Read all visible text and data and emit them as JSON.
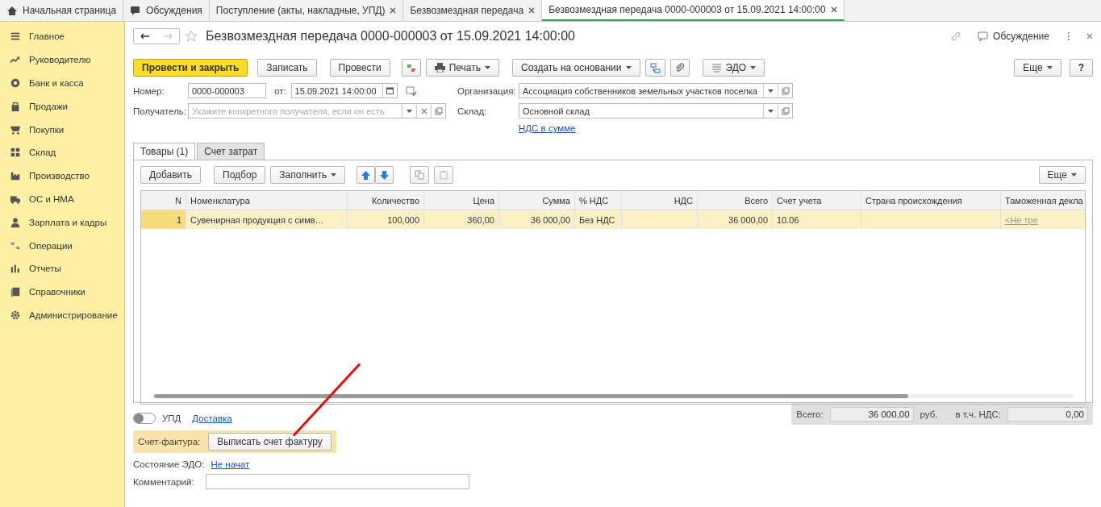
{
  "top_tabs": [
    {
      "label": "Начальная страница",
      "kind": "home",
      "closable": false,
      "selected": false
    },
    {
      "label": "Обсуждения",
      "kind": "chat",
      "closable": false,
      "selected": false
    },
    {
      "label": "Поступление (акты, накладные, УПД)",
      "kind": "doc",
      "closable": true,
      "selected": false
    },
    {
      "label": "Безвозмездная передача",
      "kind": "doc",
      "closable": true,
      "selected": false
    },
    {
      "label": "Безвозмездная передача 0000-000003 от 15.09.2021 14:00:00",
      "kind": "doc",
      "closable": true,
      "selected": true
    }
  ],
  "sidebar": {
    "items": [
      {
        "label": "Главное"
      },
      {
        "label": "Руководителю"
      },
      {
        "label": "Банк и касса"
      },
      {
        "label": "Продажи"
      },
      {
        "label": "Покупки"
      },
      {
        "label": "Склад"
      },
      {
        "label": "Производство"
      },
      {
        "label": "ОС и НМА"
      },
      {
        "label": "Зарплата и кадры"
      },
      {
        "label": "Операции"
      },
      {
        "label": "Отчеты"
      },
      {
        "label": "Справочники"
      },
      {
        "label": "Администрирование"
      }
    ]
  },
  "form": {
    "title": "Безвозмездная передача 0000-000003 от 15.09.2021 14:00:00",
    "discussion": "Обсуждение",
    "toolbar": {
      "post_close": "Провести и закрыть",
      "save": "Записать",
      "post": "Провести",
      "print": "Печать",
      "create_based": "Создать на основании",
      "edo": "ЭДО",
      "more": "Еще",
      "help": "?"
    },
    "number_label": "Номер:",
    "number": "0000-000003",
    "date_label": "от:",
    "date": "15.09.2021 14:00:00",
    "org_label": "Организация:",
    "org": "Ассоциация собственников земельных участков поселка",
    "recipient_label": "Получатель:",
    "recipient_placeholder": "Укажите конкретного получателя, если он есть",
    "warehouse_label": "Склад:",
    "warehouse": "Основной склад",
    "vat_link": "НДС в сумме",
    "tabs": [
      {
        "label": "Товары (1)",
        "selected": true
      },
      {
        "label": "Счет затрат",
        "selected": false
      }
    ],
    "table_toolbar": {
      "add": "Добавить",
      "pick": "Подбор",
      "fill": "Заполнить",
      "more": "Еще"
    },
    "table": {
      "columns": [
        "N",
        "Номенклатура",
        "Количество",
        "Цена",
        "Сумма",
        "% НДС",
        "НДС",
        "Всего",
        "Счет учета",
        "Страна происхождения",
        "Таможенная декла"
      ],
      "rows": [
        {
          "selected": true,
          "cells": [
            "1",
            "Сувенирная продукция с симв…",
            "100,000",
            "360,00",
            "36 000,00",
            "Без НДС",
            null,
            "36 000,00",
            "10.06",
            null,
            "<Не тре"
          ]
        }
      ]
    },
    "upd_toggle": {
      "label": "УПД",
      "on": false
    },
    "delivery_link": "Доставка",
    "totals": {
      "total_label": "Всего:",
      "total": "36 000,00",
      "currency": "руб.",
      "vat_label": "в т.ч. НДС:",
      "vat": "0,00"
    },
    "invoice_label": "Счет-фактура:",
    "invoice_button": "Выписать счет фактуру",
    "edo_label": "Состояние ЭДО:",
    "edo_status": "Не начат",
    "comment_label": "Комментарий:"
  }
}
